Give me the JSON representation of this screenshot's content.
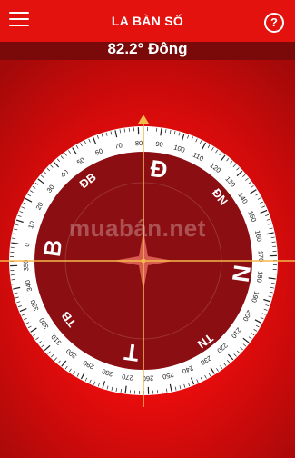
{
  "header": {
    "title": "LA BÀN SỐ",
    "help_symbol": "?"
  },
  "heading": {
    "degrees_text": "82.2° Đông",
    "degrees": 82.2
  },
  "compass": {
    "cardinals": {
      "north": "Đ",
      "east": "N",
      "south": "T",
      "west": "B"
    },
    "intercardinals": {
      "ne": "ĐN",
      "se": "TN",
      "sw": "TB",
      "nw": "ĐB"
    },
    "tick_labels": [
      "0",
      "10",
      "20",
      "30",
      "40",
      "50",
      "60",
      "70",
      "80",
      "90",
      "100",
      "110",
      "120",
      "130",
      "140",
      "150",
      "160",
      "170",
      "180",
      "190",
      "200",
      "210",
      "220",
      "230",
      "240",
      "250",
      "260",
      "270",
      "280",
      "290",
      "300",
      "310",
      "320",
      "330",
      "340",
      "350"
    ]
  },
  "watermark": "muabán.net",
  "colors": {
    "header_bg": "#e3120f",
    "heading_bar_bg": "#7a0a0a",
    "dial_fill": "#8b0e12",
    "crosshair": "#f5b84a"
  }
}
